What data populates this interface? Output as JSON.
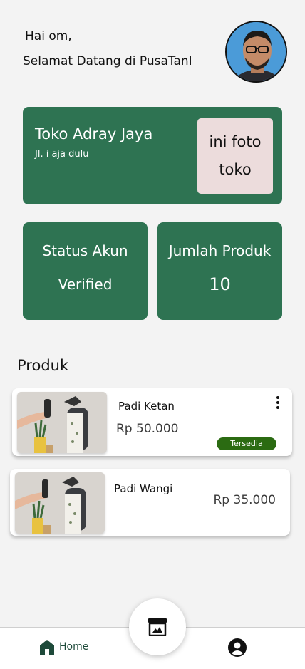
{
  "header": {
    "greeting": "Hai om,",
    "welcome": "Selamat Datang di PusaTanI"
  },
  "store": {
    "name": "Toko Adray Jaya",
    "address": "Jl. i aja dulu",
    "photo_placeholder": "ini foto toko"
  },
  "stats": [
    {
      "title": "Status Akun",
      "value": "Verified"
    },
    {
      "title": "Jumlah Produk",
      "value": "10"
    }
  ],
  "products_section": {
    "title": "Produk",
    "items": [
      {
        "name": "Padi Ketan",
        "price": "Rp 50.000",
        "badge": "Tersedia",
        "menu_icon": "more-vertical-icon"
      },
      {
        "name": "Padi Wangi",
        "price": "Rp 35.000"
      }
    ]
  },
  "nav": {
    "home_label": "Home",
    "home_icon": "home-icon",
    "center_icon": "archive-icon",
    "profile_icon": "user-circle-icon"
  },
  "colors": {
    "primary_green": "#2e7352",
    "badge_green": "#2b6b12",
    "photo_bg": "#ecdcdc"
  }
}
